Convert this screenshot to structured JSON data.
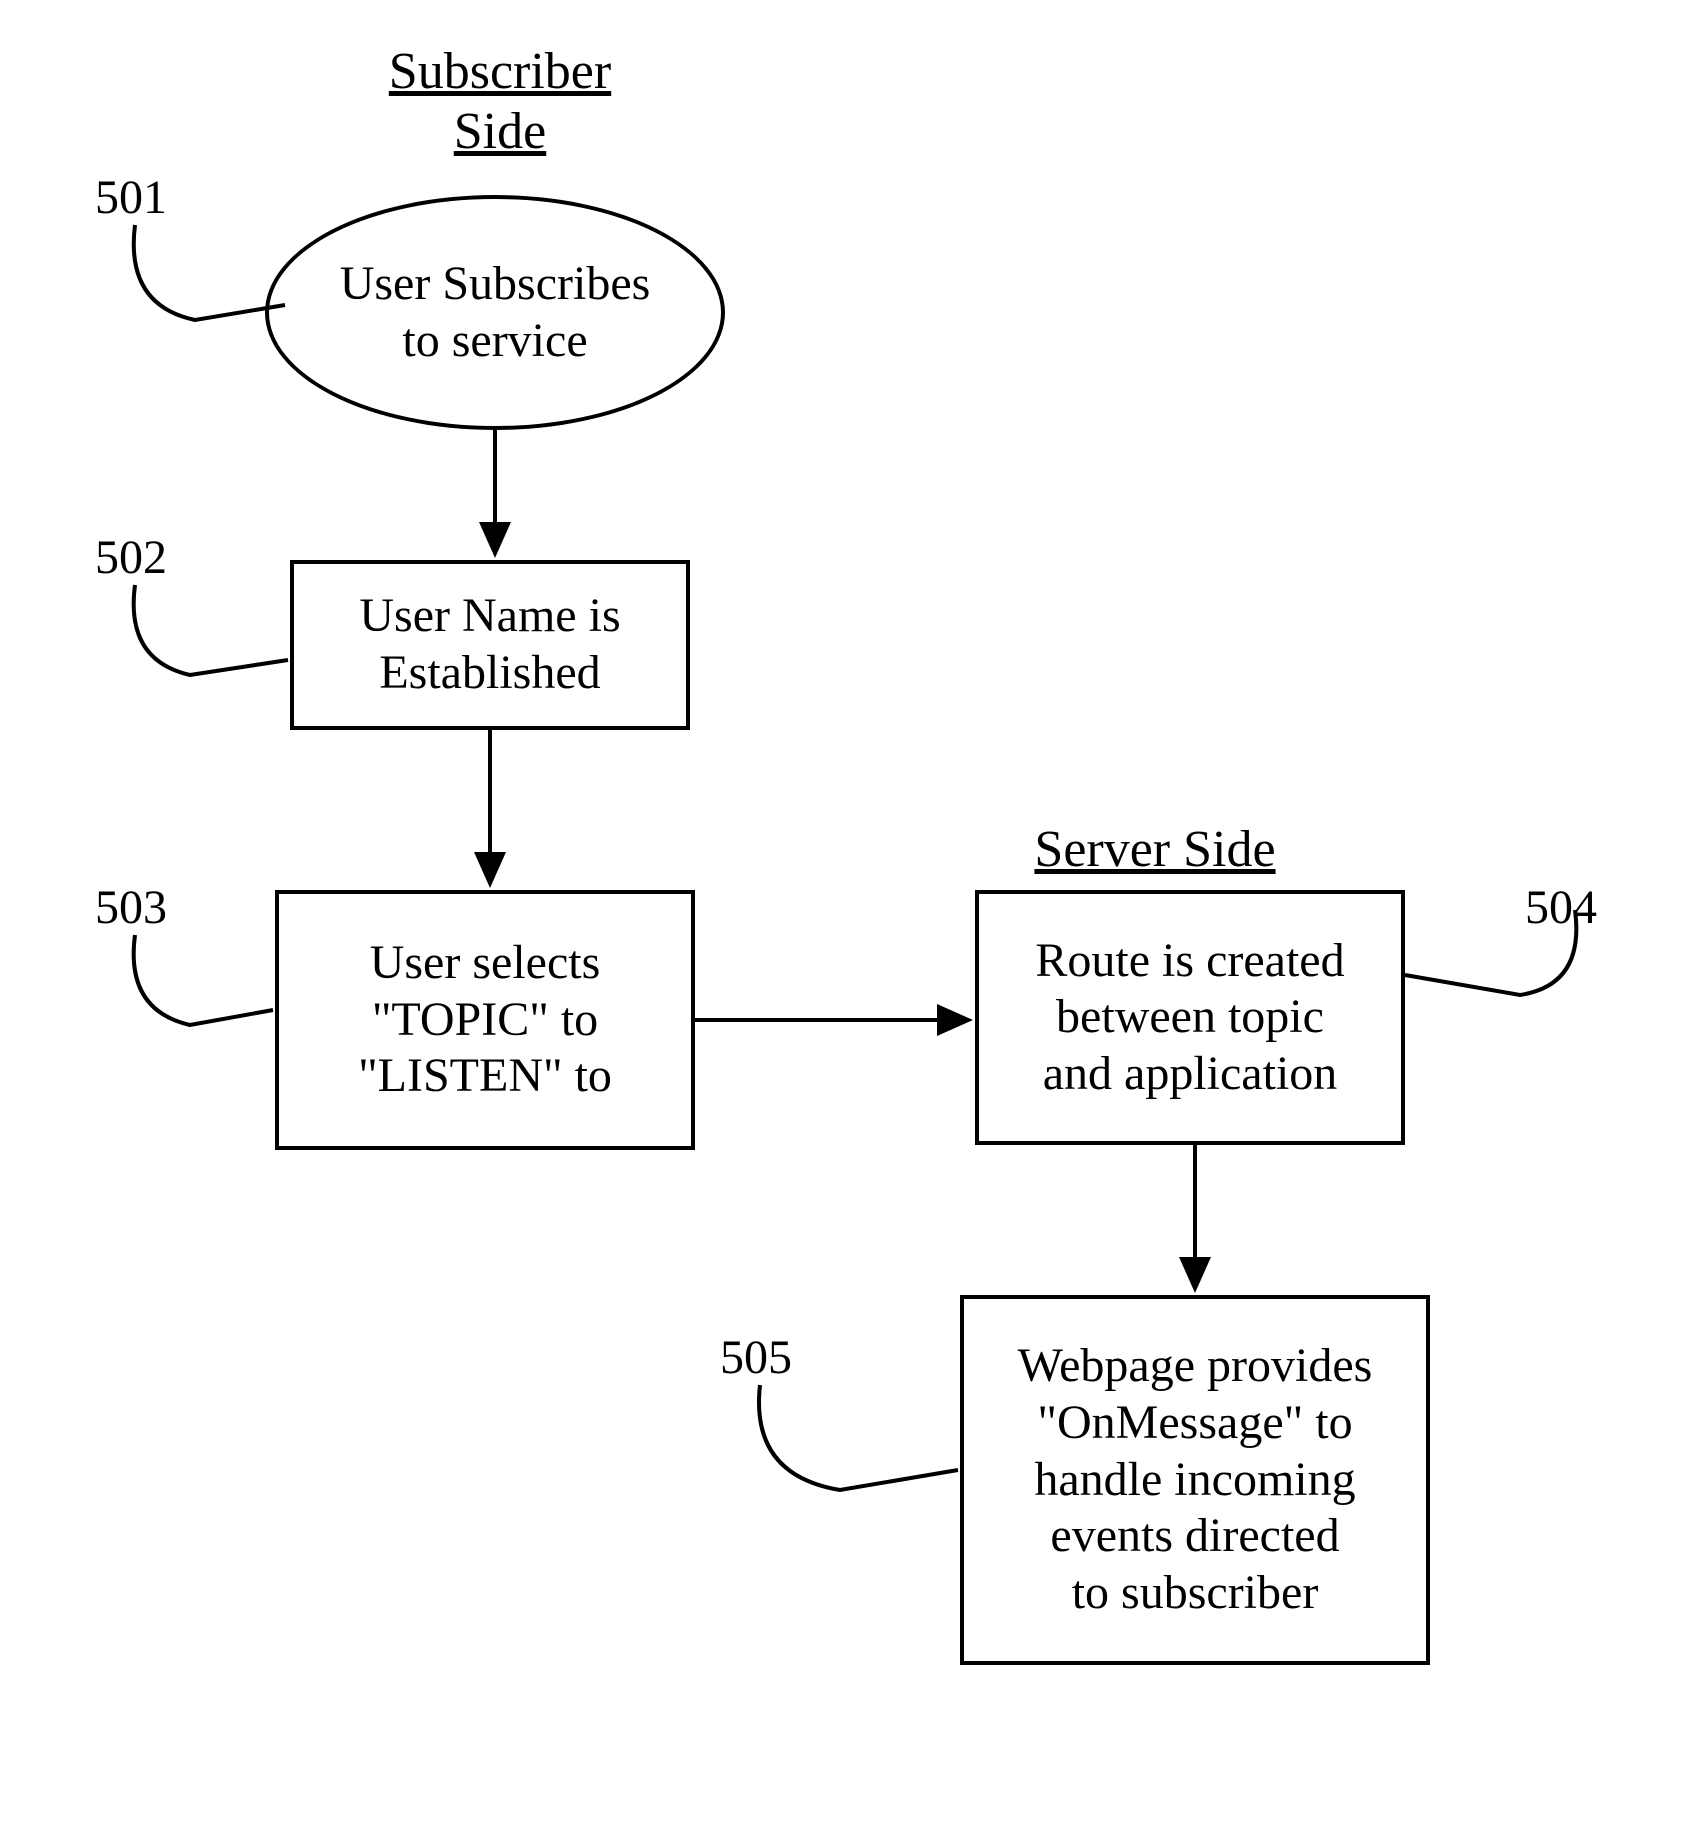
{
  "headers": {
    "subscriber": "Subscriber\nSide",
    "server": "Server Side"
  },
  "nodes": {
    "n501": {
      "ref": "501",
      "text": "User Subscribes\nto service"
    },
    "n502": {
      "ref": "502",
      "text": "User Name is\nEstablished"
    },
    "n503": {
      "ref": "503",
      "text": "User selects\n\"TOPIC\" to\n\"LISTEN\" to"
    },
    "n504": {
      "ref": "504",
      "text": "Route is created\nbetween topic\nand application"
    },
    "n505": {
      "ref": "505",
      "text": "Webpage provides\n\"OnMessage\" to\nhandle incoming\nevents directed\nto subscriber"
    }
  }
}
